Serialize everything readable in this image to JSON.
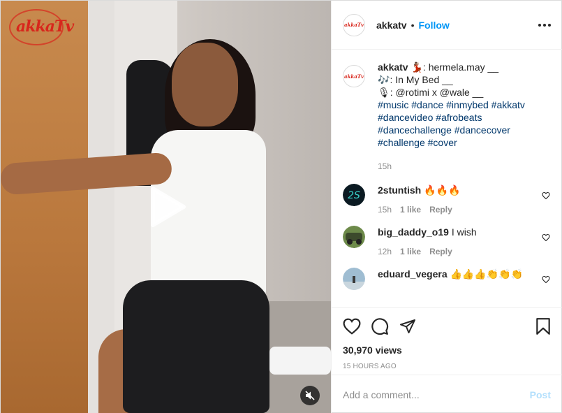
{
  "header": {
    "username": "akkatv",
    "separator": "•",
    "follow_label": "Follow",
    "avatar_text": "akkaTv"
  },
  "media": {
    "watermark_text": "akkaTv",
    "play_icon": "play-icon",
    "mute_icon": "muted-speaker-icon"
  },
  "caption": {
    "username": "akkatv",
    "line1_emoji": "💃🏽",
    "line1_text": ": hermela.may __",
    "line2_emoji": "🎶",
    "line2_text": ": In My Bed __",
    "line3_emoji": "🎙",
    "line3_text": ": @rotimi x @wale __",
    "hashtags": [
      [
        "#music",
        "#dance",
        "#inmybed",
        "#akkatv"
      ],
      [
        "#dancevideo",
        "#afrobeats"
      ],
      [
        "#dancechallenge",
        "#dancecover"
      ],
      [
        "#challenge",
        "#cover"
      ]
    ],
    "time": "15h"
  },
  "comments": [
    {
      "username": "2stuntish",
      "text": "🔥🔥🔥",
      "time": "15h",
      "likes": "1 like",
      "reply": "Reply",
      "avatar_color": "#0b1a22"
    },
    {
      "username": "big_daddy_o19",
      "text": "I wish",
      "time": "12h",
      "likes": "1 like",
      "reply": "Reply",
      "avatar_color": "#4f6a3a"
    },
    {
      "username": "eduard_vegera",
      "text": "👍👍👍👏👏👏",
      "time": "",
      "likes": "",
      "reply": "",
      "avatar_color": "#8fb0c8"
    }
  ],
  "actions": {
    "views": "30,970 views",
    "ago": "15 HOURS AGO"
  },
  "add_comment": {
    "placeholder": "Add a comment...",
    "post_label": "Post"
  },
  "colors": {
    "link": "#0095f6",
    "hashtag": "#00376b",
    "muted": "#8e8e8e",
    "post_disabled": "#b2dffc"
  }
}
